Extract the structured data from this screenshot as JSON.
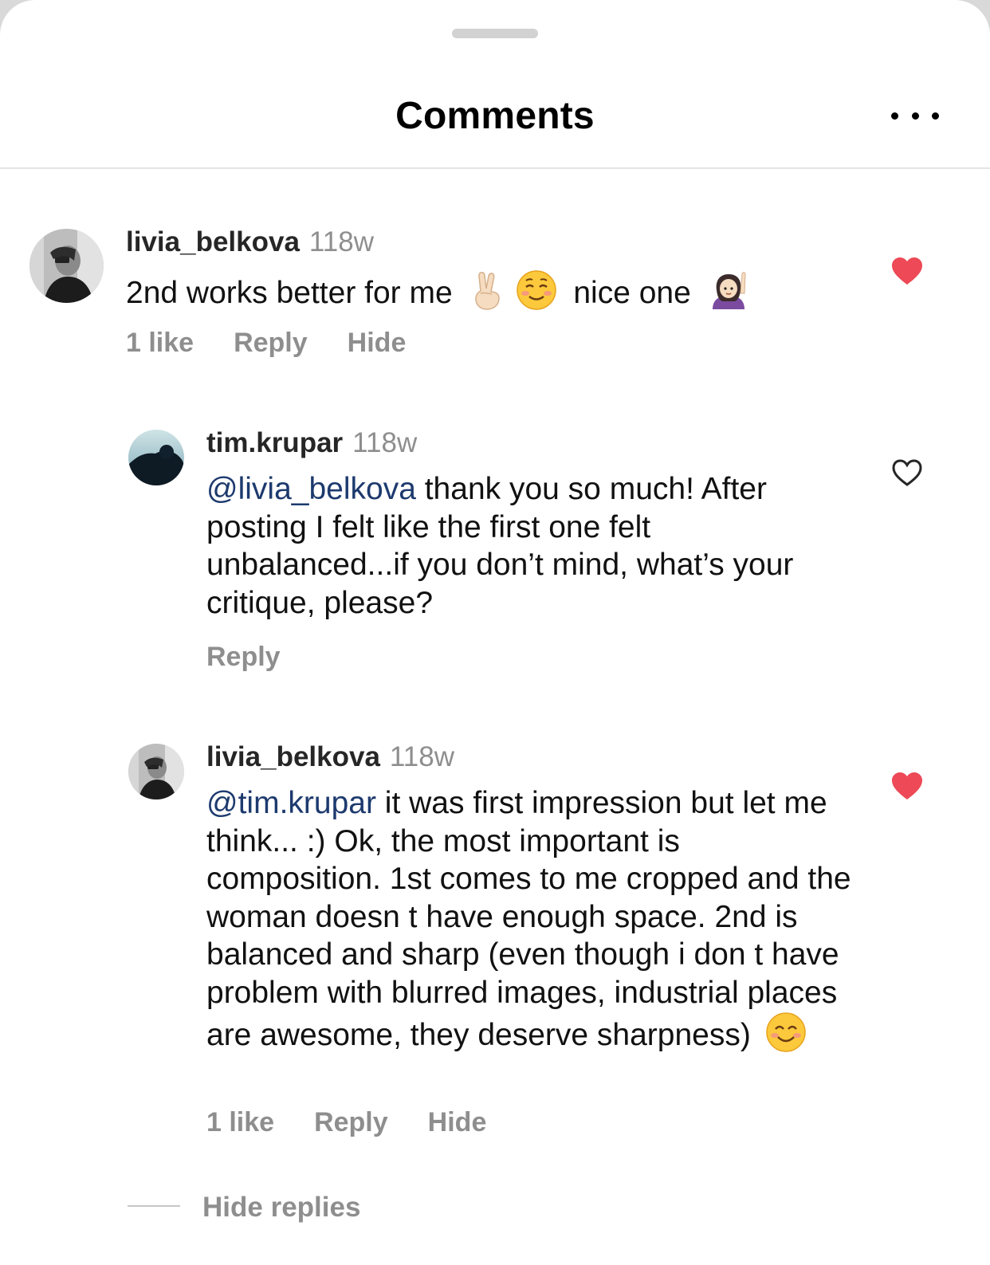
{
  "header": {
    "title": "Comments",
    "more_icon": "more-horizontal-icon"
  },
  "comments": [
    {
      "username": "livia_belkova",
      "time": "118w",
      "text_before": "2nd works better for me",
      "emoji_1": "victory-hand-emoji",
      "emoji_2": "smiling-face-emoji",
      "text_after": "nice one",
      "emoji_3": "person-raising-hand-emoji",
      "likes": "1 like",
      "reply": "Reply",
      "hide": "Hide",
      "liked": true
    },
    {
      "username": "tim.krupar",
      "time": "118w",
      "mention": "@livia_belkova",
      "text": " thank you so much! After posting I felt like the first one felt unbalanced...if you don’t mind, what’s your critique, please?",
      "reply": "Reply",
      "liked": false
    },
    {
      "username": "livia_belkova",
      "time": "118w",
      "mention": "@tim.krupar",
      "text": " it was first impression but let me think... :) Ok, the most important is composition. 1st comes to me cropped and the woman doesn t have enough space. 2nd is balanced and sharp (even though i don t have problem with blurred images, industrial places are awesome, they deserve sharpness)",
      "emoji": "smiling-face-with-smiling-eyes-emoji",
      "likes": "1 like",
      "reply": "Reply",
      "hide": "Hide",
      "liked": true
    }
  ],
  "hide_replies": "Hide replies",
  "colors": {
    "like_red": "#ed4956",
    "mention_blue": "#1d3a6e",
    "secondary_gray": "#8e8e8e"
  }
}
